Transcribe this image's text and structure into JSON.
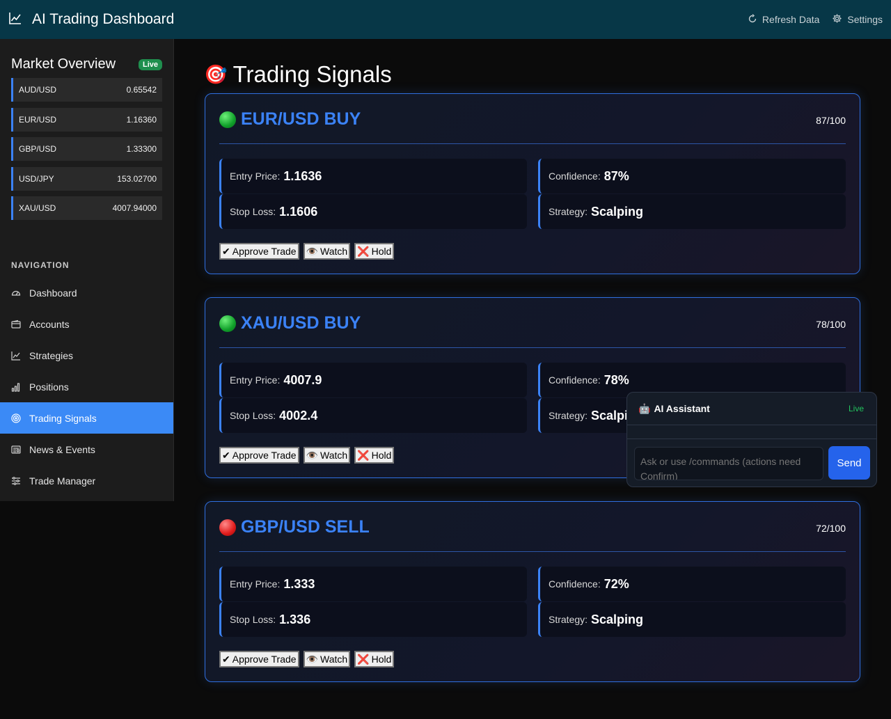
{
  "header": {
    "title": "AI Trading Dashboard",
    "refresh_label": "Refresh Data",
    "settings_label": "Settings"
  },
  "market": {
    "title": "Market Overview",
    "badge": "Live",
    "quotes": [
      {
        "pair": "AUD/USD",
        "price": "0.65542"
      },
      {
        "pair": "EUR/USD",
        "price": "1.16360"
      },
      {
        "pair": "GBP/USD",
        "price": "1.33300"
      },
      {
        "pair": "USD/JPY",
        "price": "153.02700"
      },
      {
        "pair": "XAU/USD",
        "price": "4007.94000"
      }
    ]
  },
  "navigation": {
    "label": "NAVIGATION",
    "items": [
      {
        "label": "Dashboard",
        "icon": "speedometer-icon"
      },
      {
        "label": "Accounts",
        "icon": "wallet-icon"
      },
      {
        "label": "Strategies",
        "icon": "chart-line-icon"
      },
      {
        "label": "Positions",
        "icon": "bar-chart-icon"
      },
      {
        "label": "Trading Signals",
        "icon": "target-icon",
        "active": true
      },
      {
        "label": "News & Events",
        "icon": "newspaper-icon"
      },
      {
        "label": "Trade Manager",
        "icon": "sliders-icon"
      }
    ]
  },
  "page": {
    "title": "Trading Signals",
    "title_icon": "🎯"
  },
  "signals": [
    {
      "title": "EUR/USD BUY",
      "direction_icon": "🟢",
      "score": "87/100",
      "entry_label": "Entry Price:",
      "entry": "1.1636",
      "confidence_label": "Confidence:",
      "confidence": "87%",
      "stop_label": "Stop Loss:",
      "stop": "1.1606",
      "strategy_label": "Strategy:",
      "strategy": "Scalping"
    },
    {
      "title": "XAU/USD BUY",
      "direction_icon": "🟢",
      "score": "78/100",
      "entry_label": "Entry Price:",
      "entry": "4007.9",
      "confidence_label": "Confidence:",
      "confidence": "78%",
      "stop_label": "Stop Loss:",
      "stop": "4002.4",
      "strategy_label": "Strategy:",
      "strategy": "Scalping"
    },
    {
      "title": "GBP/USD SELL",
      "direction_icon": "🔴",
      "score": "72/100",
      "entry_label": "Entry Price:",
      "entry": "1.333",
      "confidence_label": "Confidence:",
      "confidence": "72%",
      "stop_label": "Stop Loss:",
      "stop": "1.336",
      "strategy_label": "Strategy:",
      "strategy": "Scalping"
    }
  ],
  "actions": {
    "approve_icon": "✔",
    "approve": "Approve Trade",
    "watch_icon": "👁️",
    "watch": "Watch",
    "hold_icon": "❌",
    "hold": "Hold"
  },
  "assistant": {
    "icon": "🤖",
    "title": "AI Assistant",
    "status": "Live",
    "placeholder": "Ask or use /commands (actions need Confirm)",
    "send_label": "Send"
  },
  "colors": {
    "topbar": "#073747",
    "accent": "#3b82f6",
    "live": "#22c55e"
  }
}
